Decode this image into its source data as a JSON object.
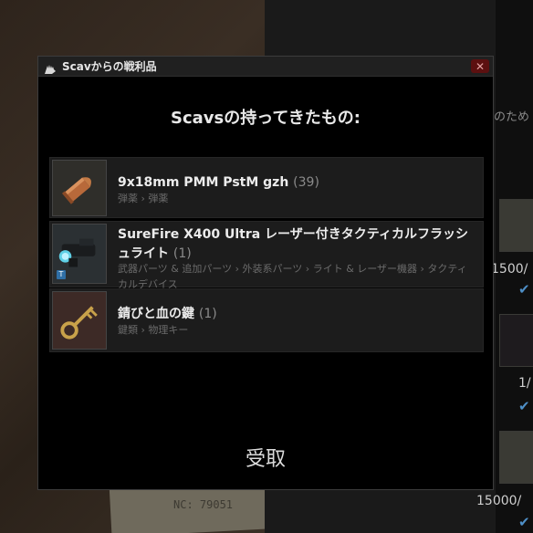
{
  "dialog": {
    "title": "Scavからの戦利品",
    "close_label": "✕",
    "heading": "Scavsの持ってきたもの:",
    "receive_label": "受取"
  },
  "loot": [
    {
      "name": "9x18mm PMM PstM gzh",
      "count": "(39)",
      "category": "弾薬 › 弾薬",
      "icon": "bullet-icon"
    },
    {
      "name": "SureFire X400 Ultra レーザー付きタクティカルフラッシュライト",
      "count": "(1)",
      "category": "武器パーツ & 追加パーツ › 外装系パーツ › ライト & レーザー機器 › タクティカルデバイス",
      "icon": "flashlight-icon",
      "badge": "T"
    },
    {
      "name": "錆びと血の鍵",
      "count": "(1)",
      "category": "鍵類 › 物理キー",
      "icon": "key-icon"
    }
  ],
  "background": {
    "partial_text": "のため",
    "price1": "1500/",
    "price2": "1/",
    "price3": "15000/",
    "paper_text": "NC: 79051"
  },
  "colors": {
    "accent_check": "#4e8fc7",
    "close_bg": "#5c1010"
  }
}
